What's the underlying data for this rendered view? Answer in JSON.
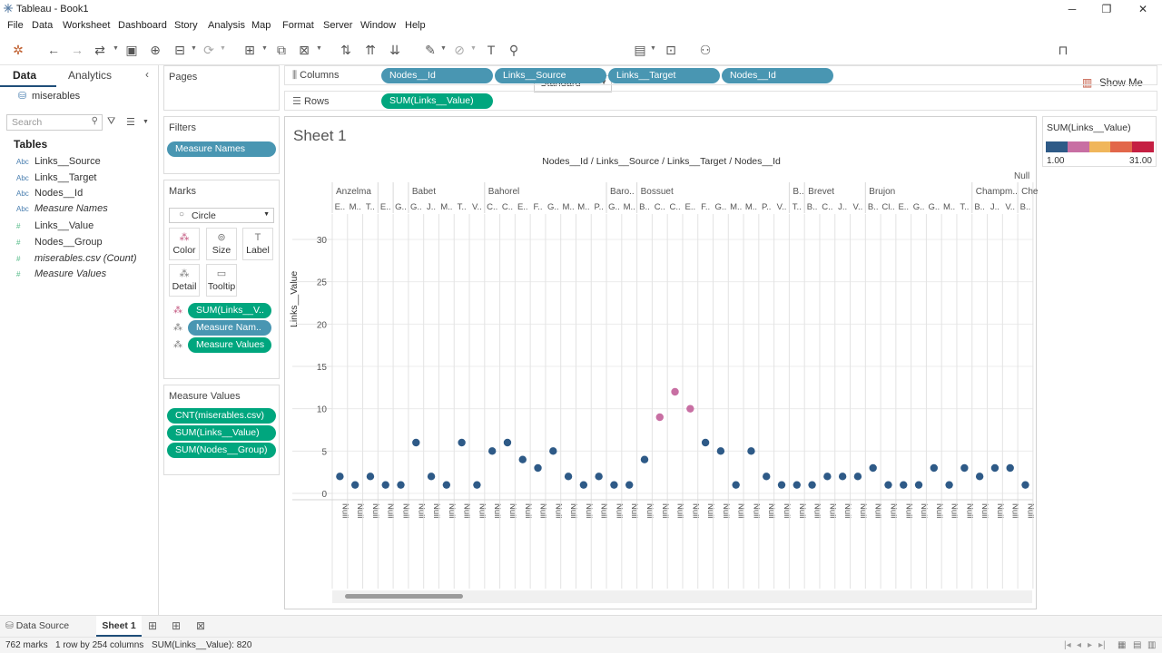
{
  "window": {
    "title": "Tableau - Book1"
  },
  "menu": [
    "File",
    "Data",
    "Worksheet",
    "Dashboard",
    "Story",
    "Analysis",
    "Map",
    "Format",
    "Server",
    "Window",
    "Help"
  ],
  "toolbar": {
    "fit_select": "Standard",
    "show_me": "Show Me"
  },
  "datapane": {
    "tabs": [
      "Data",
      "Analytics"
    ],
    "datasource": "miserables",
    "search_placeholder": "Search",
    "tables_header": "Tables",
    "fields": [
      {
        "type": "Abc",
        "name": "Links__Source",
        "italic": false
      },
      {
        "type": "Abc",
        "name": "Links__Target",
        "italic": false
      },
      {
        "type": "Abc",
        "name": "Nodes__Id",
        "italic": false
      },
      {
        "type": "Abc",
        "name": "Measure Names",
        "italic": true
      },
      {
        "type": "#",
        "name": "Links__Value",
        "italic": false
      },
      {
        "type": "#",
        "name": "Nodes__Group",
        "italic": false
      },
      {
        "type": "#",
        "name": "miserables.csv (Count)",
        "italic": true
      },
      {
        "type": "#",
        "name": "Measure Values",
        "italic": true
      }
    ]
  },
  "cards": {
    "pages": "Pages",
    "filters": {
      "title": "Filters",
      "pill": "Measure Names"
    },
    "marks": {
      "title": "Marks",
      "type": "Circle",
      "buttons": [
        "Color",
        "Size",
        "Label",
        "Detail",
        "Tooltip"
      ],
      "pills": [
        "SUM(Links__V..",
        "Measure Nam..",
        "Measure Values"
      ]
    },
    "measure_values": {
      "title": "Measure Values",
      "pills": [
        "CNT(miserables.csv)",
        "SUM(Links__Value)",
        "SUM(Nodes__Group)"
      ]
    }
  },
  "shelves": {
    "columns_label": "Columns",
    "columns": [
      "Nodes__Id",
      "Links__Source",
      "Links__Target",
      "Nodes__Id"
    ],
    "rows_label": "Rows",
    "rows": [
      "SUM(Links__Value)"
    ]
  },
  "sheet": {
    "title": "Sheet 1",
    "header_path": "Nodes__Id / Links__Source / Links__Target / Nodes__Id",
    "null_header": "Null"
  },
  "legend": {
    "title": "SUM(Links__Value)",
    "min": "1.00",
    "max": "31.00",
    "colors": [
      "#2e5a87",
      "#c86fa3",
      "#f0b65b",
      "#e2674a",
      "#c51f42"
    ]
  },
  "chart_data": {
    "type": "scatter",
    "ylabel": "Links__Value",
    "ylim": [
      0,
      33
    ],
    "yticks": [
      0,
      5,
      10,
      15,
      20,
      25,
      30
    ],
    "groups": [
      {
        "label": "Anzelma",
        "sub": [
          "E..",
          "M..",
          "T.."
        ]
      },
      {
        "label": "",
        "sub": [
          "E.."
        ]
      },
      {
        "label": "",
        "sub": [
          "G.."
        ]
      },
      {
        "label": "Babet",
        "sub": [
          "G..",
          "J..",
          "M..",
          "T..",
          "V.."
        ]
      },
      {
        "label": "Bahorel",
        "sub": [
          "C..",
          "C..",
          "E..",
          "F..",
          "G..",
          "M..",
          "M..",
          "P.."
        ]
      },
      {
        "label": "Baro..",
        "sub": [
          "G..",
          "M.."
        ]
      },
      {
        "label": "Bossuet",
        "sub": [
          "B..",
          "C..",
          "C..",
          "E..",
          "F..",
          "G..",
          "M..",
          "M..",
          "P..",
          "V.."
        ]
      },
      {
        "label": "B..",
        "sub": [
          "T.."
        ]
      },
      {
        "label": "Brevet",
        "sub": [
          "B..",
          "C..",
          "J..",
          "V.."
        ]
      },
      {
        "label": "Brujon",
        "sub": [
          "B..",
          "Cl..",
          "E..",
          "G..",
          "G..",
          "M..",
          "T.."
        ]
      },
      {
        "label": "Champm..",
        "sub": [
          "B..",
          "J..",
          "V.."
        ]
      },
      {
        "label": "Che",
        "sub": [
          "B.."
        ]
      }
    ],
    "x_tick_label": "Null",
    "values": [
      2,
      1,
      2,
      1,
      1,
      6,
      2,
      1,
      6,
      1,
      5,
      6,
      4,
      3,
      5,
      2,
      1,
      2,
      1,
      1,
      4,
      9,
      12,
      10,
      6,
      5,
      1,
      5,
      2,
      1,
      1,
      1,
      2,
      2,
      2,
      3,
      1,
      1,
      1,
      3,
      1,
      3,
      2,
      3,
      3,
      1
    ],
    "series": [
      {
        "color_by": "SUM(Links__Value)"
      }
    ]
  },
  "bottom": {
    "datasource_tab": "Data Source",
    "sheet_tab": "Sheet 1",
    "status": [
      "762 marks",
      "1 row by 254 columns",
      "SUM(Links__Value): 820"
    ]
  }
}
